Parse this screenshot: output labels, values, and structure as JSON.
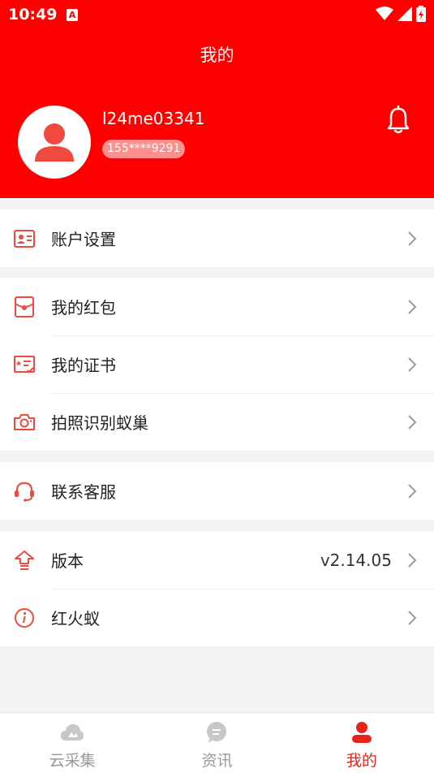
{
  "status_bar": {
    "time": "10:49",
    "notification_badge": "A"
  },
  "header": {
    "title": "我的",
    "username": "l24me03341",
    "phone": "155****9291"
  },
  "menu_groups": [
    {
      "items": [
        {
          "label": "账户设置",
          "icon": "id-card-icon"
        }
      ]
    },
    {
      "items": [
        {
          "label": "我的红包",
          "icon": "red-envelope-icon"
        },
        {
          "label": "我的证书",
          "icon": "certificate-icon"
        },
        {
          "label": "拍照识别蚁巢",
          "icon": "camera-icon"
        }
      ]
    },
    {
      "items": [
        {
          "label": "联系客服",
          "icon": "headset-icon"
        }
      ]
    },
    {
      "items": [
        {
          "label": "版本",
          "value": "v2.14.05",
          "icon": "upgrade-icon"
        },
        {
          "label": "红火蚁",
          "icon": "info-icon"
        }
      ]
    }
  ],
  "tabbar": {
    "tabs": [
      {
        "label": "云采集",
        "icon": "cloud-icon",
        "active": false
      },
      {
        "label": "资讯",
        "icon": "chat-icon",
        "active": false
      },
      {
        "label": "我的",
        "icon": "user-icon",
        "active": true
      }
    ]
  },
  "colors": {
    "brand_red": "#ff0000",
    "accent_red": "#e8231a",
    "icon_red": "#f04a3e",
    "inactive_gray": "#999999"
  }
}
